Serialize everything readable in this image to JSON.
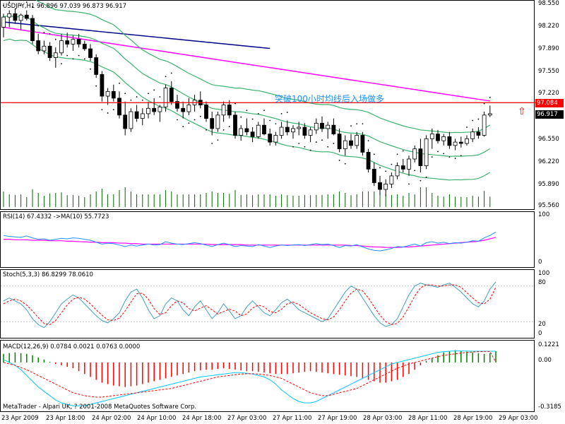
{
  "header": {
    "main": "USDJPY,H1  96.896 97.039 96.873 96.917",
    "rsi": "RSI(14) 67.4332  ->MA(10) 55.7723",
    "stoch": "Stoch(5,3,3) 86.8299 78.0610",
    "macd": "MACD(12,26,9) 0.0784 0.0021 0.0763 0.0000"
  },
  "annotation": "突破100小时均线后入场做多",
  "copyright": "MetaTrader - Alpari UK, ? 2001-2008 MetaQuotes Software Corp.",
  "price_axis": [
    "98.550",
    "98.220",
    "97.890",
    "97.550",
    "97.220",
    "96.550",
    "96.220",
    "95.890",
    "95.560"
  ],
  "tags": {
    "level": "97.084",
    "current": "96.917"
  },
  "rsi_axis": [
    "100",
    "0"
  ],
  "stoch_axis": [
    "100",
    "80",
    "20",
    "0"
  ],
  "macd_axis": [
    "0.1221",
    "0.00",
    "-0.3185"
  ],
  "time_axis": [
    "23 Apr 2009",
    "23 Apr 18:00",
    "24 Apr 02:00",
    "24 Apr 10:00",
    "24 Apr 18:00",
    "27 Apr 03:00",
    "27 Apr 11:00",
    "27 Apr 19:00",
    "28 Apr 03:00",
    "28 Apr 11:00",
    "28 Apr 19:00",
    "29 Apr 03:00"
  ],
  "colors": {
    "bull_candle": "#ffffff",
    "bear_candle": "#000000",
    "bollinger": "#3cb371",
    "ma_100": "#ff00ff",
    "ma_slow": "#00008b",
    "sar": "#000000",
    "level_line": "#ff0000",
    "volume": "#006400",
    "rsi": "#1e90ff",
    "rsi_ma": "#ff00ff",
    "stoch_main": "#40a0c0",
    "stoch_signal": "#ff0000",
    "macd_hist_pos": "#008000",
    "macd_hist_neg": "#ff0000",
    "macd_line": "#00c8ff",
    "macd_signal": "#ff0000"
  },
  "chart_data": [
    {
      "type": "candlestick",
      "symbol": "USDJPY",
      "timeframe": "H1",
      "ylim": [
        95.56,
        98.55
      ],
      "x_ticks": [
        "23 Apr 2009",
        "23 Apr 18:00",
        "24 Apr 02:00",
        "24 Apr 10:00",
        "24 Apr 18:00",
        "27 Apr 03:00",
        "27 Apr 11:00",
        "27 Apr 19:00",
        "28 Apr 03:00",
        "28 Apr 11:00",
        "28 Apr 19:00",
        "29 Apr 03:00"
      ],
      "ohlc": [
        [
          98.2,
          98.4,
          98.05,
          98.35
        ],
        [
          98.35,
          98.45,
          98.2,
          98.4
        ],
        [
          98.4,
          98.48,
          98.25,
          98.3
        ],
        [
          98.3,
          98.4,
          98.15,
          98.38
        ],
        [
          98.38,
          98.45,
          98.3,
          98.33
        ],
        [
          98.33,
          98.38,
          97.95,
          98.0
        ],
        [
          98.0,
          98.1,
          97.8,
          97.85
        ],
        [
          97.85,
          98.0,
          97.8,
          97.92
        ],
        [
          97.92,
          97.98,
          97.7,
          97.75
        ],
        [
          97.75,
          97.9,
          97.6,
          97.82
        ],
        [
          97.82,
          98.1,
          97.78,
          98.0
        ],
        [
          98.0,
          98.12,
          97.9,
          97.95
        ],
        [
          97.95,
          98.08,
          97.85,
          98.02
        ],
        [
          98.02,
          98.1,
          97.9,
          97.95
        ],
        [
          97.95,
          98.0,
          97.85,
          97.88
        ],
        [
          97.88,
          97.95,
          97.7,
          97.75
        ],
        [
          97.75,
          97.8,
          97.45,
          97.5
        ],
        [
          97.5,
          97.55,
          97.1,
          97.18
        ],
        [
          97.18,
          97.3,
          97.05,
          97.25
        ],
        [
          97.25,
          97.35,
          97.1,
          97.15
        ],
        [
          97.15,
          97.25,
          96.85,
          96.9
        ],
        [
          96.9,
          97.1,
          96.6,
          96.7
        ],
        [
          96.7,
          97.0,
          96.65,
          96.95
        ],
        [
          96.95,
          97.05,
          96.8,
          96.85
        ],
        [
          96.85,
          97.0,
          96.75,
          96.92
        ],
        [
          96.92,
          97.1,
          96.85,
          97.0
        ],
        [
          97.0,
          97.15,
          96.9,
          96.95
        ],
        [
          96.95,
          97.05,
          96.8,
          97.02
        ],
        [
          97.02,
          97.35,
          96.95,
          97.3
        ],
        [
          97.3,
          97.4,
          97.05,
          97.1
        ],
        [
          97.1,
          97.2,
          96.95,
          97.0
        ],
        [
          97.0,
          97.1,
          96.85,
          96.95
        ],
        [
          96.95,
          97.15,
          96.9,
          97.05
        ],
        [
          97.05,
          97.2,
          96.95,
          97.12
        ],
        [
          97.12,
          97.25,
          97.0,
          97.05
        ],
        [
          97.05,
          97.1,
          96.8,
          96.85
        ],
        [
          96.85,
          96.95,
          96.6,
          96.7
        ],
        [
          96.7,
          96.95,
          96.65,
          96.9
        ],
        [
          96.9,
          97.1,
          96.8,
          97.05
        ],
        [
          97.05,
          97.12,
          96.85,
          96.9
        ],
        [
          96.9,
          96.95,
          96.55,
          96.6
        ],
        [
          96.6,
          96.75,
          96.52,
          96.7
        ],
        [
          96.7,
          96.85,
          96.6,
          96.65
        ],
        [
          96.65,
          96.72,
          96.5,
          96.58
        ],
        [
          96.58,
          96.8,
          96.55,
          96.75
        ],
        [
          96.75,
          96.85,
          96.6,
          96.62
        ],
        [
          96.62,
          96.7,
          96.45,
          96.5
        ],
        [
          96.5,
          96.65,
          96.45,
          96.6
        ],
        [
          96.6,
          96.8,
          96.55,
          96.72
        ],
        [
          96.72,
          96.82,
          96.6,
          96.65
        ],
        [
          96.65,
          96.75,
          96.55,
          96.7
        ],
        [
          96.7,
          96.8,
          96.6,
          96.72
        ],
        [
          96.72,
          96.78,
          96.55,
          96.6
        ],
        [
          96.6,
          96.72,
          96.5,
          96.68
        ],
        [
          96.68,
          96.85,
          96.62,
          96.78
        ],
        [
          96.78,
          96.88,
          96.65,
          96.7
        ],
        [
          96.7,
          96.8,
          96.55,
          96.75
        ],
        [
          96.75,
          96.85,
          96.6,
          96.62
        ],
        [
          96.62,
          96.7,
          96.35,
          96.4
        ],
        [
          96.4,
          96.6,
          96.3,
          96.52
        ],
        [
          96.52,
          96.62,
          96.4,
          96.45
        ],
        [
          96.45,
          96.65,
          96.4,
          96.6
        ],
        [
          96.6,
          96.65,
          96.3,
          96.35
        ],
        [
          96.35,
          96.4,
          96.05,
          96.1
        ],
        [
          96.1,
          96.2,
          95.85,
          95.9
        ],
        [
          95.9,
          96.0,
          95.72,
          95.8
        ],
        [
          95.8,
          95.95,
          95.7,
          95.88
        ],
        [
          95.88,
          96.05,
          95.82,
          96.0
        ],
        [
          96.0,
          96.2,
          95.95,
          96.15
        ],
        [
          96.15,
          96.25,
          96.05,
          96.1
        ],
        [
          96.1,
          96.3,
          96.0,
          96.25
        ],
        [
          96.25,
          96.45,
          96.2,
          96.4
        ],
        [
          96.4,
          96.55,
          96.05,
          96.15
        ],
        [
          96.15,
          96.6,
          96.1,
          96.55
        ],
        [
          96.55,
          96.7,
          96.4,
          96.62
        ],
        [
          96.62,
          96.68,
          96.48,
          96.52
        ],
        [
          96.52,
          96.62,
          96.45,
          96.58
        ],
        [
          96.58,
          96.65,
          96.4,
          96.45
        ],
        [
          96.45,
          96.55,
          96.38,
          96.5
        ],
        [
          96.5,
          96.58,
          96.42,
          96.48
        ],
        [
          96.48,
          96.6,
          96.45,
          96.55
        ],
        [
          96.55,
          96.7,
          96.5,
          96.65
        ],
        [
          96.65,
          96.72,
          96.55,
          96.6
        ],
        [
          96.6,
          96.95,
          96.58,
          96.9
        ],
        [
          96.9,
          97.04,
          96.87,
          96.92
        ]
      ],
      "reference_level": 97.084,
      "current_price": 96.917
    },
    {
      "type": "line",
      "name_shown": "RSI(14)",
      "ylim": [
        0,
        100
      ],
      "series_rsi": [
        60,
        58,
        57,
        56,
        59,
        55,
        52,
        53,
        50,
        52,
        54,
        53,
        55,
        54,
        52,
        50,
        46,
        42,
        44,
        43,
        40,
        37,
        40,
        38,
        40,
        42,
        40,
        41,
        47,
        44,
        42,
        41,
        43,
        45,
        43,
        40,
        37,
        41,
        44,
        41,
        37,
        39,
        38,
        37,
        41,
        38,
        35,
        38,
        40,
        39,
        40,
        41,
        39,
        41,
        43,
        41,
        42,
        39,
        35,
        39,
        38,
        41,
        36,
        32,
        29,
        28,
        30,
        33,
        37,
        36,
        39,
        42,
        38,
        45,
        47,
        44,
        46,
        43,
        45,
        44,
        46,
        49,
        48,
        55,
        60,
        67
      ],
      "series_ma": [
        52,
        52,
        51,
        51,
        51,
        50,
        50,
        50,
        49,
        49,
        49,
        48,
        48,
        47,
        47,
        46,
        46,
        45,
        45,
        45,
        44,
        44,
        43,
        43,
        42,
        42,
        42,
        42,
        42,
        42,
        42,
        42,
        42,
        42,
        42,
        42,
        41,
        41,
        41,
        41,
        41,
        41,
        40,
        40,
        40,
        40,
        40,
        40,
        40,
        40,
        40,
        40,
        40,
        40,
        40,
        40,
        40,
        40,
        40,
        40,
        39,
        39,
        38,
        37,
        36,
        36,
        35,
        35,
        35,
        36,
        36,
        37,
        38,
        39,
        40,
        41,
        42,
        43,
        44,
        45,
        46,
        47,
        48,
        50,
        53,
        56
      ]
    },
    {
      "type": "line",
      "name_shown": "Stoch(5,3,3)",
      "ylim": [
        0,
        100
      ],
      "series_main": [
        55,
        60,
        55,
        50,
        40,
        25,
        15,
        10,
        20,
        35,
        50,
        58,
        65,
        60,
        50,
        40,
        30,
        22,
        18,
        25,
        35,
        55,
        70,
        75,
        60,
        40,
        25,
        30,
        50,
        60,
        55,
        40,
        30,
        45,
        55,
        40,
        25,
        35,
        50,
        38,
        25,
        30,
        45,
        55,
        45,
        35,
        30,
        40,
        52,
        58,
        50,
        40,
        35,
        30,
        25,
        20,
        25,
        40,
        55,
        70,
        80,
        75,
        60,
        45,
        30,
        18,
        12,
        15,
        25,
        45,
        65,
        80,
        85,
        82,
        80,
        78,
        82,
        85,
        78,
        70,
        60,
        50,
        45,
        55,
        75,
        87
      ],
      "series_signal": [
        50,
        55,
        58,
        55,
        48,
        38,
        27,
        17,
        15,
        22,
        35,
        48,
        58,
        61,
        58,
        50,
        40,
        31,
        23,
        22,
        26,
        38,
        53,
        67,
        68,
        58,
        42,
        32,
        35,
        47,
        55,
        52,
        42,
        38,
        43,
        47,
        40,
        33,
        37,
        41,
        38,
        30,
        33,
        43,
        48,
        45,
        37,
        35,
        41,
        50,
        53,
        49,
        42,
        35,
        30,
        25,
        23,
        28,
        40,
        55,
        68,
        75,
        72,
        60,
        45,
        31,
        20,
        15,
        17,
        28,
        45,
        63,
        77,
        82,
        82,
        80,
        80,
        82,
        82,
        78,
        69,
        60,
        52,
        50,
        58,
        78
      ]
    },
    {
      "type": "bar",
      "name_shown": "MACD(12,26,9)",
      "ylim": [
        -0.3185,
        0.1221
      ],
      "histogram": [
        0.06,
        0.065,
        0.07,
        0.065,
        0.06,
        0.05,
        0.035,
        0.02,
        0.005,
        -0.01,
        -0.02,
        -0.03,
        -0.04,
        -0.06,
        -0.08,
        -0.1,
        -0.12,
        -0.14,
        -0.15,
        -0.16,
        -0.165,
        -0.17,
        -0.165,
        -0.16,
        -0.15,
        -0.14,
        -0.13,
        -0.12,
        -0.11,
        -0.1,
        -0.09,
        -0.08,
        -0.07,
        -0.06,
        -0.055,
        -0.05,
        -0.05,
        -0.045,
        -0.04,
        -0.045,
        -0.05,
        -0.055,
        -0.06,
        -0.06,
        -0.065,
        -0.07,
        -0.075,
        -0.08,
        -0.08,
        -0.08,
        -0.075,
        -0.07,
        -0.065,
        -0.06,
        -0.065,
        -0.07,
        -0.075,
        -0.08,
        -0.085,
        -0.09,
        -0.095,
        -0.1,
        -0.11,
        -0.12,
        -0.13,
        -0.14,
        -0.14,
        -0.13,
        -0.12,
        -0.1,
        -0.08,
        -0.05,
        -0.02,
        0.01,
        0.03,
        0.05,
        0.07,
        0.08,
        0.085,
        0.08,
        0.075,
        0.07,
        0.065,
        0.06,
        0.065,
        0.078
      ],
      "macd_line": [
        0.02,
        0.0,
        -0.02,
        -0.05,
        -0.09,
        -0.13,
        -0.17,
        -0.2,
        -0.23,
        -0.26,
        -0.28,
        -0.29,
        -0.3,
        -0.3,
        -0.3,
        -0.29,
        -0.28,
        -0.27,
        -0.26,
        -0.25,
        -0.24,
        -0.23,
        -0.22,
        -0.21,
        -0.2,
        -0.19,
        -0.18,
        -0.17,
        -0.16,
        -0.15,
        -0.14,
        -0.13,
        -0.12,
        -0.11,
        -0.1,
        -0.095,
        -0.09,
        -0.085,
        -0.08,
        -0.075,
        -0.07,
        -0.07,
        -0.075,
        -0.08,
        -0.09,
        -0.1,
        -0.12,
        -0.15,
        -0.19,
        -0.22,
        -0.25,
        -0.27,
        -0.28,
        -0.28,
        -0.27,
        -0.25,
        -0.23,
        -0.21,
        -0.19,
        -0.17,
        -0.15,
        -0.13,
        -0.11,
        -0.09,
        -0.07,
        -0.05,
        -0.03,
        -0.01,
        0.0,
        0.01,
        0.02,
        0.03,
        0.04,
        0.05,
        0.06,
        0.07,
        0.075,
        0.078,
        0.08,
        0.08,
        0.079,
        0.078,
        0.078,
        0.078,
        0.078,
        0.078
      ],
      "signal_line": [
        0.0,
        -0.01,
        -0.02,
        -0.035,
        -0.05,
        -0.07,
        -0.09,
        -0.11,
        -0.13,
        -0.15,
        -0.17,
        -0.19,
        -0.21,
        -0.22,
        -0.23,
        -0.235,
        -0.24,
        -0.24,
        -0.235,
        -0.23,
        -0.225,
        -0.22,
        -0.215,
        -0.21,
        -0.205,
        -0.2,
        -0.195,
        -0.19,
        -0.185,
        -0.18,
        -0.17,
        -0.16,
        -0.15,
        -0.14,
        -0.13,
        -0.12,
        -0.11,
        -0.1,
        -0.095,
        -0.09,
        -0.085,
        -0.08,
        -0.078,
        -0.078,
        -0.08,
        -0.085,
        -0.09,
        -0.1,
        -0.11,
        -0.13,
        -0.15,
        -0.17,
        -0.19,
        -0.21,
        -0.22,
        -0.23,
        -0.23,
        -0.22,
        -0.21,
        -0.2,
        -0.19,
        -0.18,
        -0.16,
        -0.14,
        -0.12,
        -0.1,
        -0.08,
        -0.06,
        -0.04,
        -0.025,
        -0.01,
        0.0,
        0.01,
        0.02,
        0.03,
        0.04,
        0.05,
        0.055,
        0.06,
        0.065,
        0.07,
        0.072,
        0.075,
        0.076,
        0.076,
        0.002
      ]
    }
  ]
}
